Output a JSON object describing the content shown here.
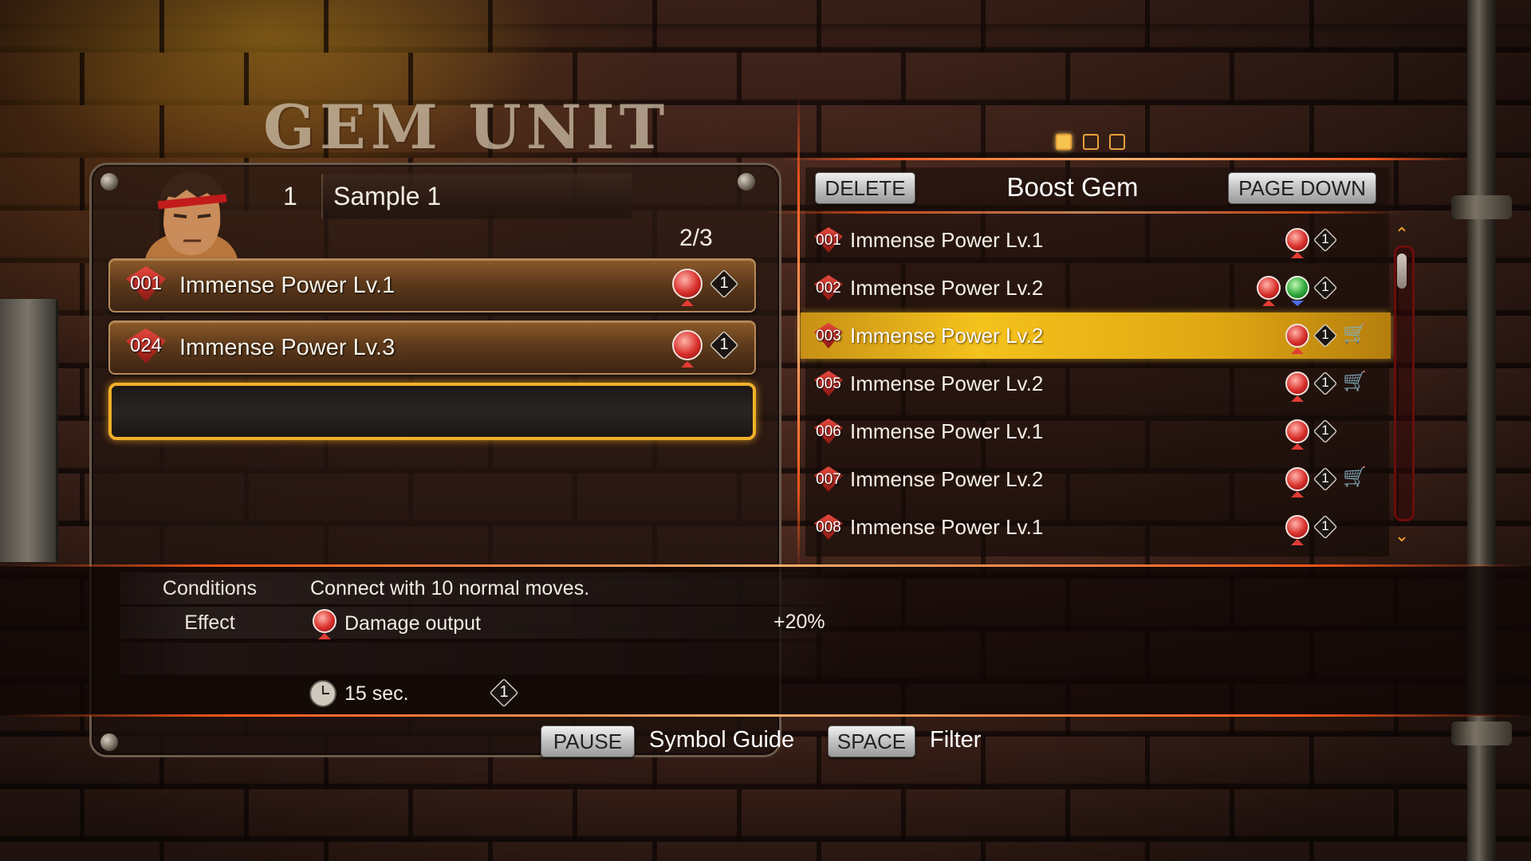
{
  "screen": {
    "title": "GEM UNIT"
  },
  "unit": {
    "number": "1",
    "name": "Sample 1",
    "capacity": "2/3"
  },
  "equipped": [
    {
      "id": "001",
      "label": "Immense Power Lv.1",
      "cost": "1"
    },
    {
      "id": "024",
      "label": "Immense Power Lv.3",
      "cost": "1"
    }
  ],
  "pagination": {
    "pages": 3,
    "current": 1
  },
  "list": {
    "title": "Boost Gem",
    "delete_label": "DELETE",
    "page_down_label": "PAGE DOWN",
    "items": [
      {
        "id": "001",
        "label": "Immense Power Lv.1",
        "cost": "1",
        "speed_icon": false,
        "cart": false,
        "selected": false
      },
      {
        "id": "002",
        "label": "Immense Power Lv.2",
        "cost": "1",
        "speed_icon": true,
        "cart": false,
        "selected": false
      },
      {
        "id": "003",
        "label": "Immense Power Lv.2",
        "cost": "1",
        "speed_icon": false,
        "cart": true,
        "selected": true
      },
      {
        "id": "005",
        "label": "Immense Power Lv.2",
        "cost": "1",
        "speed_icon": false,
        "cart": true,
        "selected": false
      },
      {
        "id": "006",
        "label": "Immense Power Lv.1",
        "cost": "1",
        "speed_icon": false,
        "cart": false,
        "selected": false
      },
      {
        "id": "007",
        "label": "Immense Power Lv.2",
        "cost": "1",
        "speed_icon": false,
        "cart": true,
        "selected": false
      },
      {
        "id": "008",
        "label": "Immense Power Lv.1",
        "cost": "1",
        "speed_icon": false,
        "cart": false,
        "selected": false
      }
    ]
  },
  "details": {
    "conditions_label": "Conditions",
    "conditions": "Connect with 10 normal moves.",
    "effect_label": "Effect",
    "effect": "Damage output",
    "effect_value": "+20%",
    "duration": "15 sec.",
    "cost": "1"
  },
  "footer": {
    "pause_key": "PAUSE",
    "pause_label": "Symbol Guide",
    "space_key": "SPACE",
    "space_label": "Filter"
  },
  "colors": {
    "accent": "#f4c21c",
    "glow": "#ff5a1c",
    "gem_red": "#d92f2b"
  }
}
